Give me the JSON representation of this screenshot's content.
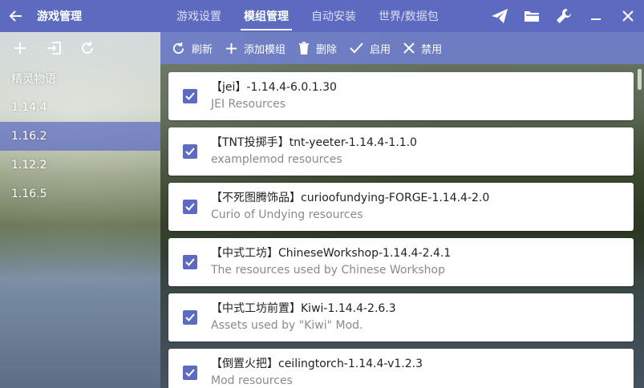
{
  "header": {
    "title": "游戏管理",
    "tabs": [
      {
        "label": "游戏设置"
      },
      {
        "label": "模组管理"
      },
      {
        "label": "自动安装"
      },
      {
        "label": "世界/数据包"
      }
    ],
    "active_tab": "模组管理"
  },
  "sidebar": {
    "versions": [
      {
        "label": "精灵物语"
      },
      {
        "label": "1.14.4"
      },
      {
        "label": "1.16.2"
      },
      {
        "label": "1.12.2"
      },
      {
        "label": "1.16.5"
      }
    ],
    "selected": "1.16.2"
  },
  "toolbar": {
    "refresh_label": "刷新",
    "add_label": "添加模组",
    "delete_label": "删除",
    "enable_label": "启用",
    "disable_label": "禁用"
  },
  "mods": [
    {
      "name": "【jei】-1.14.4-6.0.1.30",
      "desc": "JEI Resources",
      "checked": true
    },
    {
      "name": "【TNT投掷手】tnt-yeeter-1.14.4-1.1.0",
      "desc": "examplemod resources",
      "checked": true
    },
    {
      "name": "【不死图腾饰品】curioofundying-FORGE-1.14.4-2.0",
      "desc": "Curio of Undying resources",
      "checked": true
    },
    {
      "name": "【中式工坊】ChineseWorkshop-1.14.4-2.4.1",
      "desc": "The resources used by Chinese Workshop",
      "checked": true
    },
    {
      "name": "【中式工坊前置】Kiwi-1.14.4-2.6.3",
      "desc": "Assets used by \"Kiwi\" Mod.",
      "checked": true
    },
    {
      "name": "【倒置火把】ceilingtorch-1.14.4-v1.2.3",
      "desc": "Mod resources",
      "checked": true
    }
  ],
  "colors": {
    "accent": "#5c6bc0"
  }
}
